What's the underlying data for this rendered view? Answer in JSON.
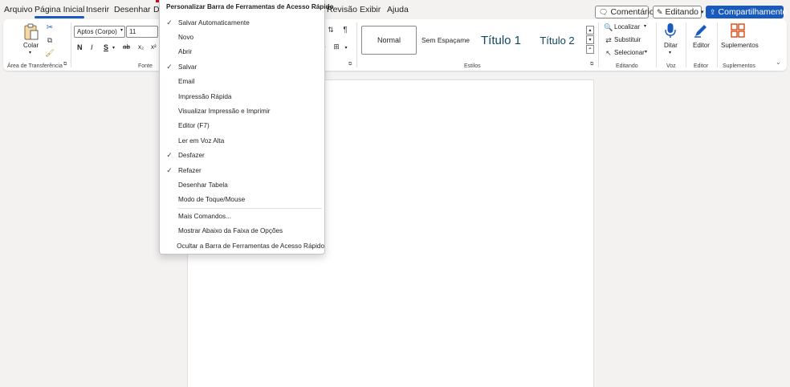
{
  "tabs": [
    "Arquivo",
    "Página Inicial",
    "Inserir",
    "Desenhar",
    "D",
    "Revisão",
    "Exibir",
    "Ajuda"
  ],
  "topbar": {
    "comments_label": "Comentários",
    "editing_label": "Editando",
    "share_label": "Compartilhamento"
  },
  "ribbon": {
    "clipboard": {
      "paste_label": "Colar",
      "group_label": "Área de Transferência"
    },
    "font": {
      "font_name": "Aptos (Corpo)",
      "font_size": "11",
      "bold": "N",
      "italic": "I",
      "underline": "S",
      "strike": "ab",
      "subscript": "x₂",
      "superscript": "x²",
      "group_label": "Fonte"
    },
    "styles": {
      "items": [
        "Normal",
        "Sem Espaçame",
        "Título 1",
        "Título 2"
      ],
      "group_label": "Estilos"
    },
    "editing": {
      "find_label": "Localizar",
      "replace_label": "Substituir",
      "select_label": "Selecionar",
      "group_label": "Editando"
    },
    "voice": {
      "dictate_label": "Ditar",
      "group_label": "Voz"
    },
    "editor": {
      "editor_label": "Editor",
      "group_label": "Editor"
    },
    "addins": {
      "addins_label": "Suplementos",
      "group_label": "Suplementos"
    }
  },
  "qat_menu": {
    "title": "Personalizar Barra de Ferramentas de Acesso Rápido",
    "items": [
      {
        "label": "Salvar Automaticamente",
        "checked": true
      },
      {
        "label": "Novo",
        "checked": false
      },
      {
        "label": "Abrir",
        "checked": false
      },
      {
        "label": "Salvar",
        "checked": true
      },
      {
        "label": "Email",
        "checked": false
      },
      {
        "label": "Impressão Rápida",
        "checked": false
      },
      {
        "label": "Visualizar Impressão e Imprimir",
        "checked": false
      },
      {
        "label": "Editor (F7)",
        "checked": false
      },
      {
        "label": "Ler em Voz Alta",
        "checked": false
      },
      {
        "label": "Desfazer",
        "checked": true
      },
      {
        "label": "Refazer",
        "checked": true
      },
      {
        "label": "Desenhar Tabela",
        "checked": false
      },
      {
        "label": "Modo de Toque/Mouse",
        "checked": false
      }
    ],
    "extra_items": [
      "Mais Comandos...",
      "Mostrar Abaixo da Faixa de Opções",
      "Ocultar a Barra de Ferramentas de Acesso Rápido"
    ],
    "check_glyph": "✓"
  },
  "colors": {
    "accent": "#185abd",
    "menu_accent": "#c50f1f",
    "background": "#f3f2f1"
  }
}
